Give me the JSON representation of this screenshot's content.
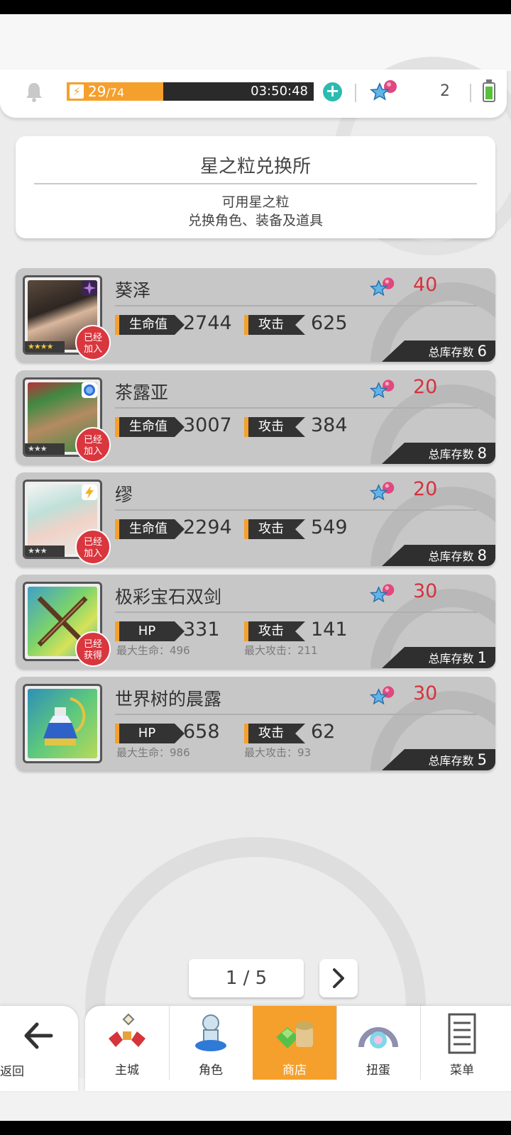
{
  "header": {
    "energy_current": "29",
    "energy_sep": "/",
    "energy_max": "74",
    "energy_fraction": 0.39,
    "timer": "03:50:48",
    "star_count": "2"
  },
  "info": {
    "title": "星之粒兑换所",
    "line1": "可用星之粒",
    "line2": "兑换角色、装备及道具"
  },
  "items": [
    {
      "name": "葵泽",
      "price": "40",
      "stat1_label": "生命值",
      "stat1_value": "2744",
      "stat2_label": "攻击",
      "stat2_value": "625",
      "badge": "已经\n加入",
      "badge_l1": "已经",
      "badge_l2": "加入",
      "stock_label": "总库存数",
      "stock": "6",
      "stars": "★★★★"
    },
    {
      "name": "茶露亚",
      "price": "20",
      "stat1_label": "生命值",
      "stat1_value": "3007",
      "stat2_label": "攻击",
      "stat2_value": "384",
      "badge_l1": "已经",
      "badge_l2": "加入",
      "stock_label": "总库存数",
      "stock": "8",
      "stars": "★★★"
    },
    {
      "name": "缪",
      "price": "20",
      "stat1_label": "生命值",
      "stat1_value": "2294",
      "stat2_label": "攻击",
      "stat2_value": "549",
      "badge_l1": "已经",
      "badge_l2": "加入",
      "stock_label": "总库存数",
      "stock": "8",
      "stars": "★★★"
    },
    {
      "name": "极彩宝石双剑",
      "price": "30",
      "stat1_label": "HP",
      "stat1_value": "331",
      "stat1_max": "最大生命：496",
      "stat2_label": "攻击",
      "stat2_value": "141",
      "stat2_max": "最大攻击：211",
      "badge_l1": "已经",
      "badge_l2": "获得",
      "stock_label": "总库存数",
      "stock": "1"
    },
    {
      "name": "世界树的晨露",
      "price": "30",
      "stat1_label": "HP",
      "stat1_value": "658",
      "stat1_max": "最大生命：986",
      "stat2_label": "攻击",
      "stat2_value": "62",
      "stat2_max": "最大攻击：93",
      "stock_label": "总库存数",
      "stock": "5"
    }
  ],
  "pager": {
    "text": "1 / 5"
  },
  "nav": {
    "back": "返回",
    "main": "主城",
    "characters": "角色",
    "shop": "商店",
    "gacha": "扭蛋",
    "menu": "菜单"
  },
  "colors": {
    "accent": "#f5a02c",
    "price_red": "#d4333c",
    "badge_red": "#d9363e",
    "teal": "#2bbbb0"
  }
}
